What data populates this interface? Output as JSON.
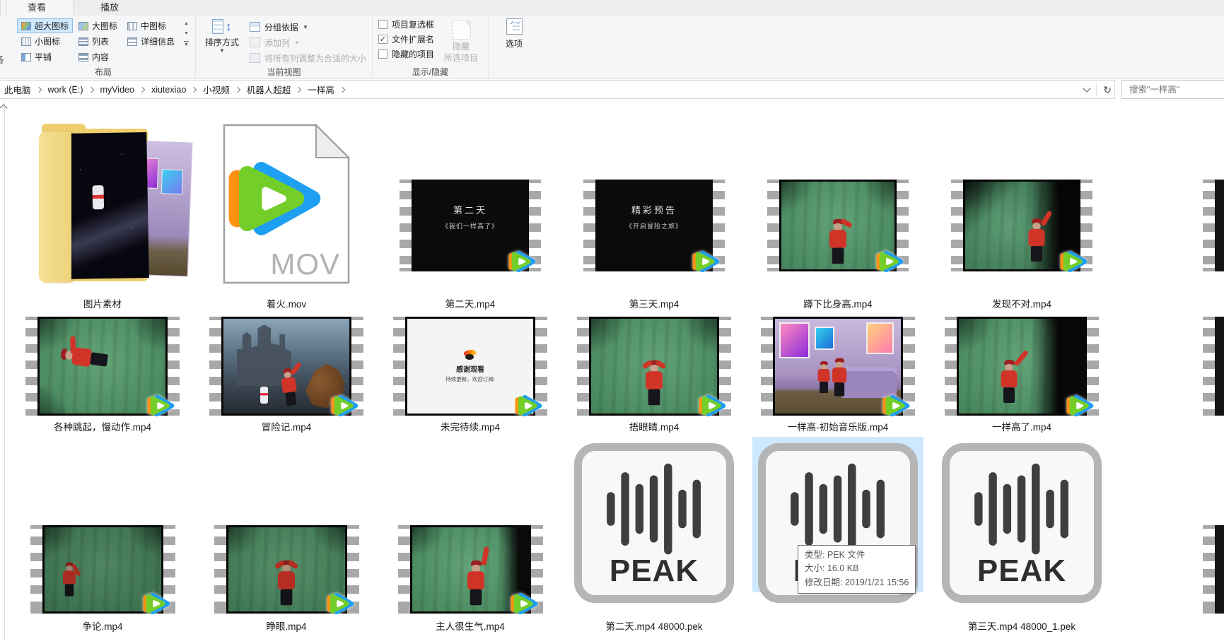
{
  "colors": {
    "selection": "#cde8ff",
    "tencent_orange": "#ff9212",
    "tencent_green": "#74ce2a",
    "tencent_blue": "#1f9ff2"
  },
  "ribbon": {
    "tabs": [
      {
        "label": "查看",
        "active": true
      },
      {
        "label": "播放",
        "active": false
      }
    ],
    "left_edge_text": "各",
    "layout_group": {
      "label": "布局",
      "options": [
        {
          "label": "超大图标",
          "selected": true
        },
        {
          "label": "大图标",
          "selected": false
        },
        {
          "label": "中图标",
          "selected": false
        },
        {
          "label": "小图标",
          "selected": false
        },
        {
          "label": "列表",
          "selected": false
        },
        {
          "label": "详细信息",
          "selected": false
        },
        {
          "label": "平铺",
          "selected": false
        },
        {
          "label": "内容",
          "selected": false
        }
      ]
    },
    "view_group": {
      "label": "当前视图",
      "sort_button": "排序方式",
      "group_by": "分组依据",
      "add_columns": "添加列",
      "size_columns": "将所有列调整为合适的大小"
    },
    "show_group": {
      "label": "显示/隐藏",
      "checkboxes": [
        {
          "label": "项目复选框",
          "checked": false
        },
        {
          "label": "文件扩展名",
          "checked": true
        },
        {
          "label": "隐藏的项目",
          "checked": false
        }
      ],
      "hide_selected_line1": "隐藏",
      "hide_selected_line2": "所选项目"
    },
    "options_button": "选项"
  },
  "address_bar": {
    "breadcrumb": [
      "此电脑",
      "work (E:)",
      "myVideo",
      "xiutexiao",
      "小视频",
      "机器人超超",
      "一样高"
    ],
    "search_placeholder": "搜索\"一样高\""
  },
  "files": {
    "mov_badge": "MOV",
    "peak_badge": "PEAK",
    "rows": [
      [
        {
          "kind": "folder",
          "name": "图片素材"
        },
        {
          "kind": "mov",
          "name": "着火.mov"
        },
        {
          "kind": "film",
          "scene": "black",
          "name": "第二天.mp4",
          "line1": "第二天",
          "line2": "《我们一样高了》"
        },
        {
          "kind": "film",
          "scene": "black",
          "name": "第三天.mp4",
          "line1": "精彩预告",
          "line2": "《开启冒险之旅》"
        },
        {
          "kind": "film",
          "scene": "g-stand",
          "name": "蹲下比身高.mp4"
        },
        {
          "kind": "film",
          "scene": "g-darkright",
          "name": "发现不对.mp4"
        }
      ],
      [
        {
          "kind": "film",
          "scene": "g-lying",
          "name": "各种跳起，慢动作.mp4"
        },
        {
          "kind": "film",
          "scene": "fantasy",
          "name": "冒险记.mp4"
        },
        {
          "kind": "film",
          "scene": "thanks",
          "name": "未完待续.mp4",
          "line1": "感谢观看",
          "line2": "持续更新，欢迎订阅!"
        },
        {
          "kind": "film",
          "scene": "g-cover",
          "name": "捂眼睛.mp4"
        },
        {
          "kind": "film",
          "scene": "purple",
          "name": "一样高-初始音乐版.mp4"
        },
        {
          "kind": "film",
          "scene": "g-armdark",
          "name": "一样高了.mp4"
        }
      ],
      [
        {
          "kind": "film",
          "scene": "g-small",
          "name": "争论.mp4"
        },
        {
          "kind": "film",
          "scene": "g-cover-dim",
          "name": "睁眼.mp4"
        },
        {
          "kind": "film",
          "scene": "g-armup",
          "name": "主人很生气.mp4"
        },
        {
          "kind": "peak",
          "name": "第二天.mp4 48000.pek",
          "selected": false
        },
        {
          "kind": "peak",
          "name": "",
          "selected": true
        },
        {
          "kind": "peak",
          "name": "第三天.mp4 48000_1.pek",
          "selected": false
        }
      ]
    ]
  },
  "tooltip": {
    "lines": [
      "类型: PEK 文件",
      "大小: 16.0 KB",
      "修改日期: 2019/1/21 15:56"
    ]
  }
}
